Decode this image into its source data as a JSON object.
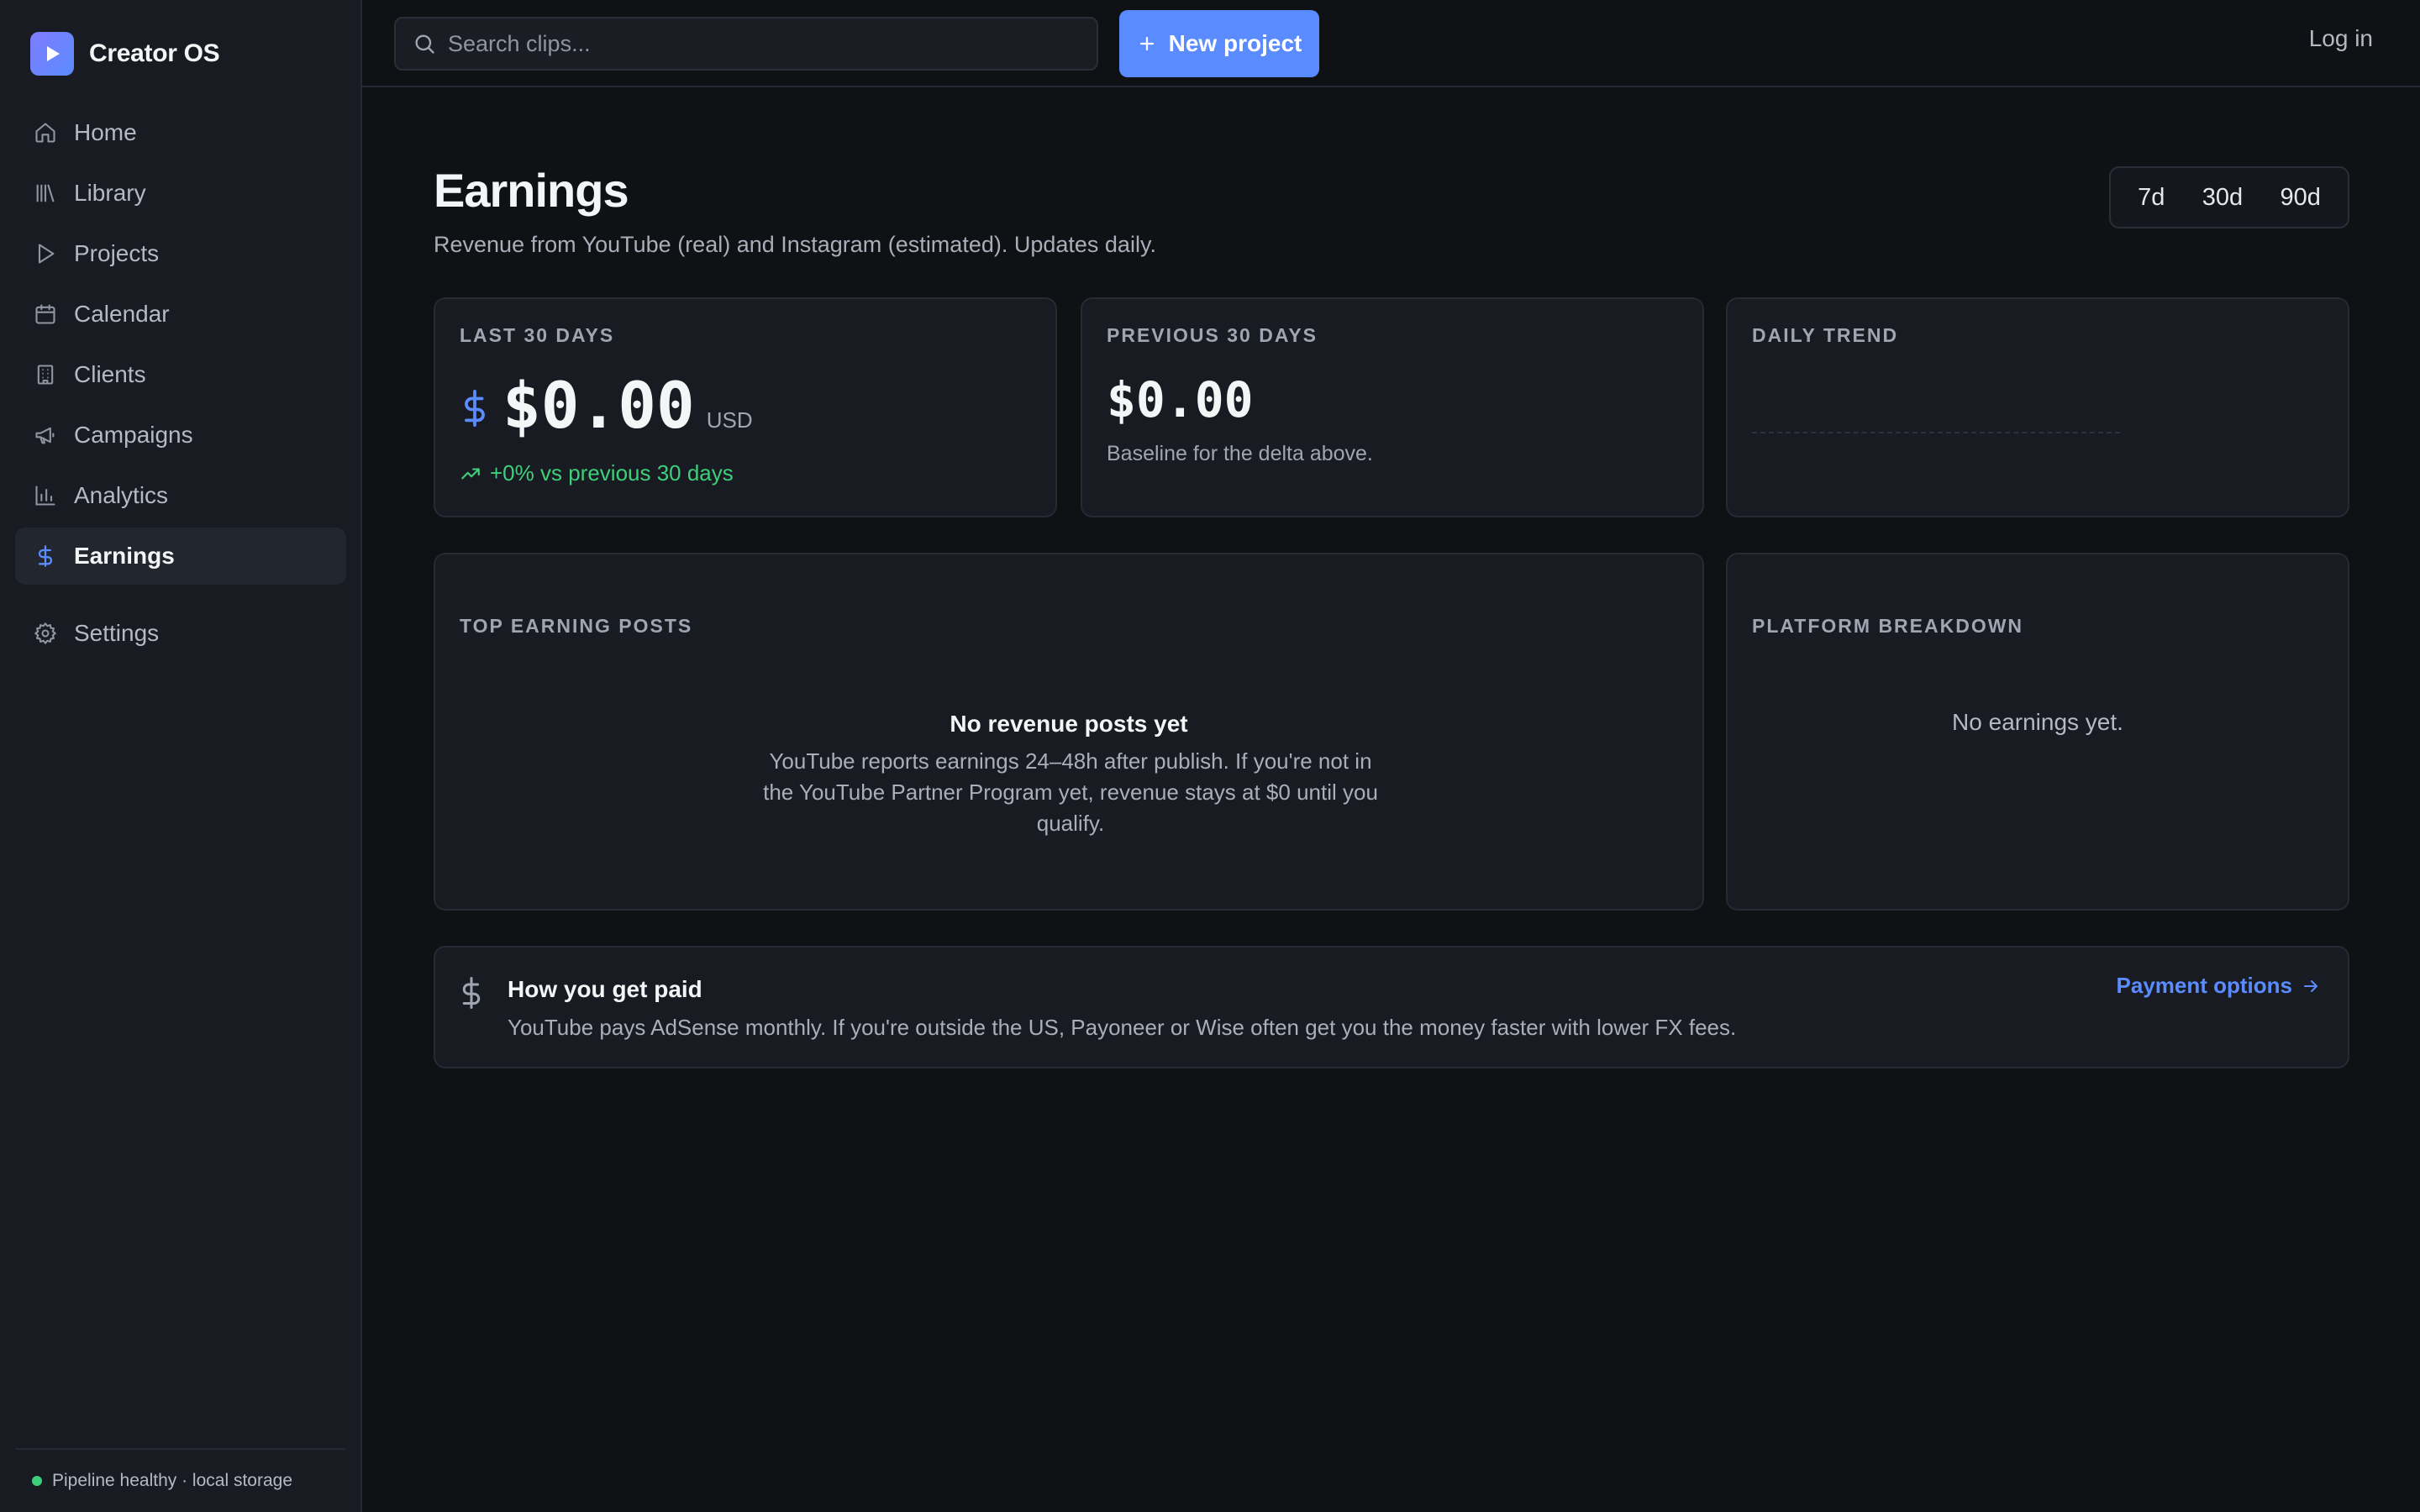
{
  "app": {
    "name": "Creator OS"
  },
  "sidebar": {
    "items": [
      {
        "label": "Home",
        "icon": "home-icon"
      },
      {
        "label": "Library",
        "icon": "library-icon"
      },
      {
        "label": "Projects",
        "icon": "play-icon"
      },
      {
        "label": "Calendar",
        "icon": "calendar-icon"
      },
      {
        "label": "Clients",
        "icon": "building-icon"
      },
      {
        "label": "Campaigns",
        "icon": "megaphone-icon"
      },
      {
        "label": "Analytics",
        "icon": "bar-chart-icon"
      },
      {
        "label": "Earnings",
        "icon": "dollar-icon",
        "active": true
      },
      {
        "label": "Settings",
        "icon": "gear-icon"
      }
    ],
    "footer": "Pipeline healthy · local storage",
    "status_color": "#3ecf7a"
  },
  "topbar": {
    "search": {
      "placeholder": "Search clips...",
      "value": ""
    },
    "new_project_label": "New project",
    "login_label": "Log in"
  },
  "page": {
    "title": "Earnings",
    "subtitle": "Revenue from YouTube (real) and Instagram (estimated). Updates daily.",
    "range_options": [
      "7d",
      "30d",
      "90d"
    ]
  },
  "stats": {
    "last30": {
      "label": "Last 30 days",
      "value": "$0.00",
      "currency": "USD",
      "delta": "+0% vs previous 30 days"
    },
    "prev30": {
      "label": "Previous 30 days",
      "value": "$0.00",
      "note": "Baseline for the delta above."
    },
    "trend": {
      "label": "Daily trend"
    }
  },
  "posts": {
    "label": "Top earning posts",
    "empty_title": "No revenue posts yet",
    "empty_desc": "YouTube reports earnings 24–48h after publish. If you're not in the YouTube Partner Program yet, revenue stays at $0 until you qualify."
  },
  "platform": {
    "label": "Platform breakdown",
    "empty": "No earnings yet."
  },
  "payout": {
    "title": "How you get paid",
    "desc": "YouTube pays AdSense monthly. If you're outside the US, Payoneer or Wise often get you the money faster with lower FX fees.",
    "link": "Payment options"
  },
  "colors": {
    "accent": "#5b8cff",
    "positive": "#3ecf7a",
    "background": "#0f1115",
    "sidebar": "#181b22"
  }
}
